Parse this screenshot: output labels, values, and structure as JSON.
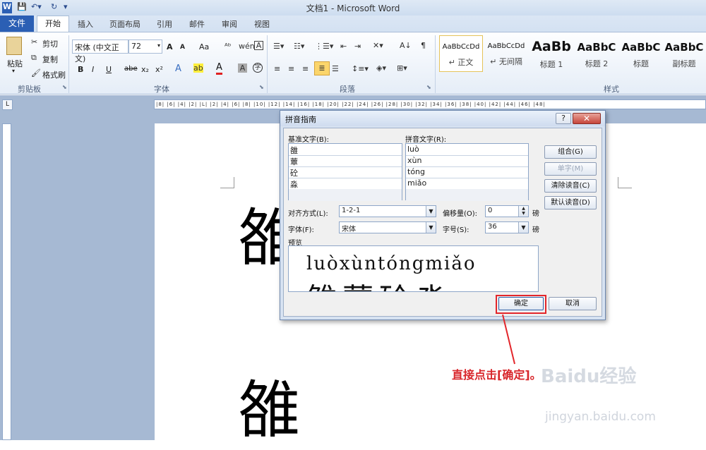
{
  "window": {
    "title": "文档1 - Microsoft Word"
  },
  "tabs": {
    "file": "文件",
    "home": "开始",
    "insert": "插入",
    "layout": "页面布局",
    "references": "引用",
    "mailings": "邮件",
    "review": "审阅",
    "view": "视图"
  },
  "clipboard": {
    "paste": "粘贴",
    "cut": "剪切",
    "copy": "复制",
    "format_painter": "格式刷",
    "group": "剪贴板"
  },
  "font": {
    "name": "宋体 (中文正文)",
    "size": "72",
    "grow": "A",
    "shrink": "A",
    "case": "Aa",
    "bold": "B",
    "italic": "I",
    "underline": "U",
    "strike": "abe",
    "sub": "x₂",
    "sup": "x²",
    "group": "字体"
  },
  "paragraph": {
    "group": "段落"
  },
  "styles": {
    "group": "样式",
    "items": [
      {
        "sample": "AaBbCcDd",
        "name": "↵ 正文"
      },
      {
        "sample": "AaBbCcDd",
        "name": "↵ 无间隔"
      },
      {
        "sample": "AaBb",
        "name": "标题 1"
      },
      {
        "sample": "AaBbC",
        "name": "标题 2"
      },
      {
        "sample": "AaBbC",
        "name": "标题"
      },
      {
        "sample": "AaBbC",
        "name": "副标题"
      }
    ]
  },
  "ruler": {
    "ticks": "|8| |6| |4| |2| |L| |2| |4| |6| |8| |10| |12| |14| |16| |18| |20| |22| |24| |26| |28| |30| |32| |34| |36| |38| |40| |42| |44| |46| |48|"
  },
  "document": {
    "char1": "雒",
    "char2": "雒"
  },
  "dialog": {
    "title": "拼音指南",
    "help": "?",
    "close": "✕",
    "base_header": "基准文字(B):",
    "ruby_header": "拼音文字(R):",
    "rows": [
      {
        "base": "雒",
        "ruby": "luò"
      },
      {
        "base": "蕈",
        "ruby": "xùn"
      },
      {
        "base": "砼",
        "ruby": "tóng"
      },
      {
        "base": "淼",
        "ruby": "miǎo"
      },
      {
        "base": "",
        "ruby": ""
      }
    ],
    "btn_group": "组合(G)",
    "btn_single": "单字(M)",
    "btn_clear": "清除读音(C)",
    "btn_default": "默认读音(D)",
    "align_label": "对齐方式(L):",
    "align_value": "1-2-1",
    "offset_label": "偏移量(O):",
    "offset_value": "0",
    "offset_unit": "磅",
    "font_label": "字体(F):",
    "font_value": "宋体",
    "size_label": "字号(S):",
    "size_value": "36",
    "size_unit": "磅",
    "preview_label": "预览",
    "preview_pinyin": "luòxùntóngmiǎo",
    "preview_base": "雒蕈砼淼",
    "ok": "确定",
    "cancel": "取消"
  },
  "annotation": {
    "text": "直接点击[确定]。",
    "color": "#d8262b"
  },
  "watermark": {
    "logo": "Baidu经验",
    "url": "jingyan.baidu.com"
  }
}
